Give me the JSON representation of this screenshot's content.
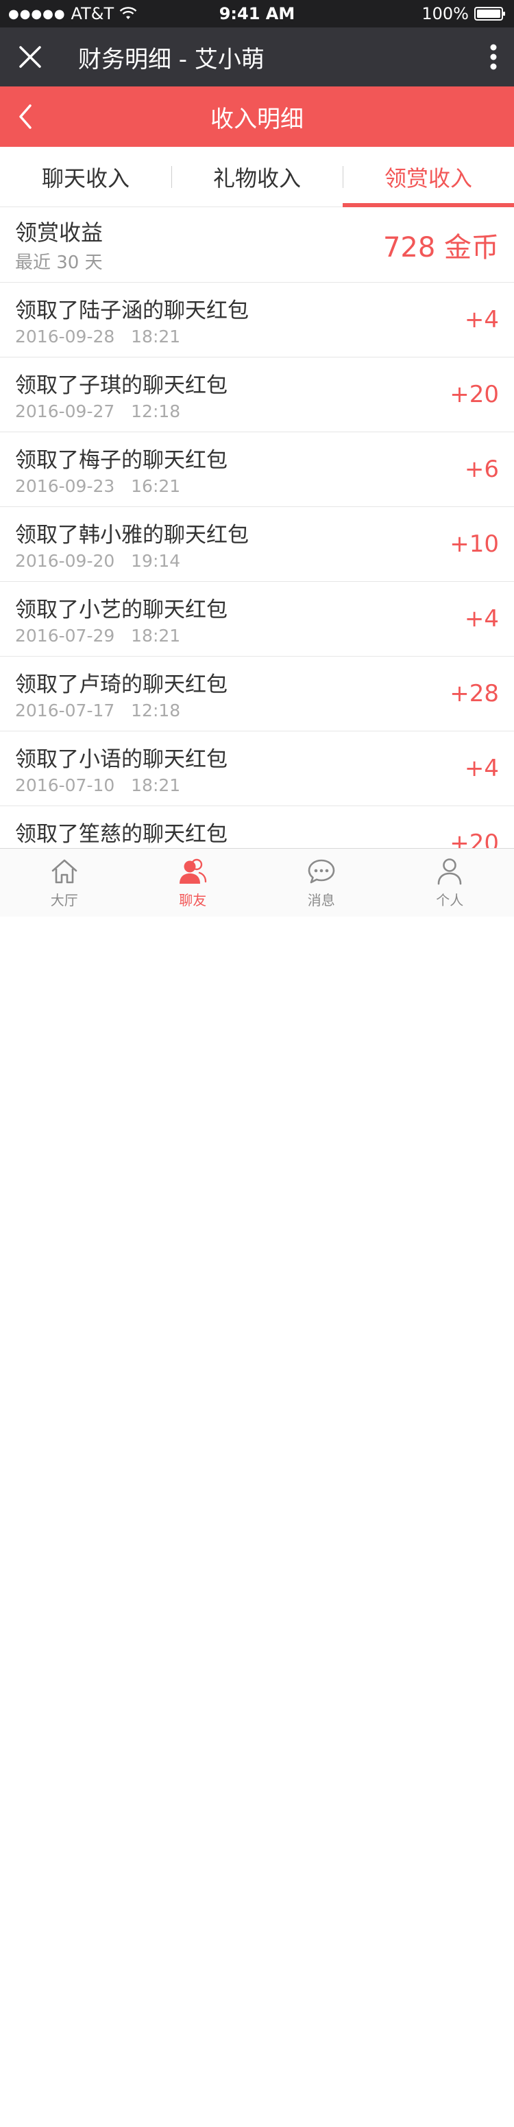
{
  "status_bar": {
    "signal": "●●●●●",
    "carrier": "AT&T",
    "time": "9:41 AM",
    "battery": "100%"
  },
  "wechat_bar": {
    "title": "财务明细 - 艾小萌"
  },
  "header": {
    "title": "收入明细"
  },
  "tabs": [
    {
      "label": "聊天收入",
      "active": false
    },
    {
      "label": "礼物收入",
      "active": false
    },
    {
      "label": "领赏收入",
      "active": true
    }
  ],
  "summary": {
    "title": "领赏收益",
    "subtitle": "最近 30 天",
    "amount": "728 金币"
  },
  "items": [
    {
      "title": "领取了陆子涵的聊天红包",
      "date": "2016-09-28",
      "time": "18:21",
      "amount": "+4"
    },
    {
      "title": "领取了子琪的聊天红包",
      "date": "2016-09-27",
      "time": "12:18",
      "amount": "+20"
    },
    {
      "title": "领取了梅子的聊天红包",
      "date": "2016-09-23",
      "time": "16:21",
      "amount": "+6"
    },
    {
      "title": "领取了韩小雅的聊天红包",
      "date": "2016-09-20",
      "time": "19:14",
      "amount": "+10"
    },
    {
      "title": "领取了小艺的聊天红包",
      "date": "2016-07-29",
      "time": "18:21",
      "amount": "+4"
    },
    {
      "title": "领取了卢琦的聊天红包",
      "date": "2016-07-17",
      "time": "12:18",
      "amount": "+28"
    },
    {
      "title": "领取了小语的聊天红包",
      "date": "2016-07-10",
      "time": "18:21",
      "amount": "+4"
    },
    {
      "title": "领取了笙慈的聊天红包",
      "date": "",
      "time": "",
      "amount": "+20"
    }
  ],
  "tabbar": [
    {
      "label": "大厅",
      "icon": "home-icon",
      "active": false
    },
    {
      "label": "聊友",
      "icon": "friends-icon",
      "active": true
    },
    {
      "label": "消息",
      "icon": "message-icon",
      "active": false
    },
    {
      "label": "个人",
      "icon": "person-icon",
      "active": false
    }
  ],
  "colors": {
    "accent": "#f25757",
    "status_bar_bg": "#1f1f21",
    "nav_bar_bg": "#35353a"
  }
}
